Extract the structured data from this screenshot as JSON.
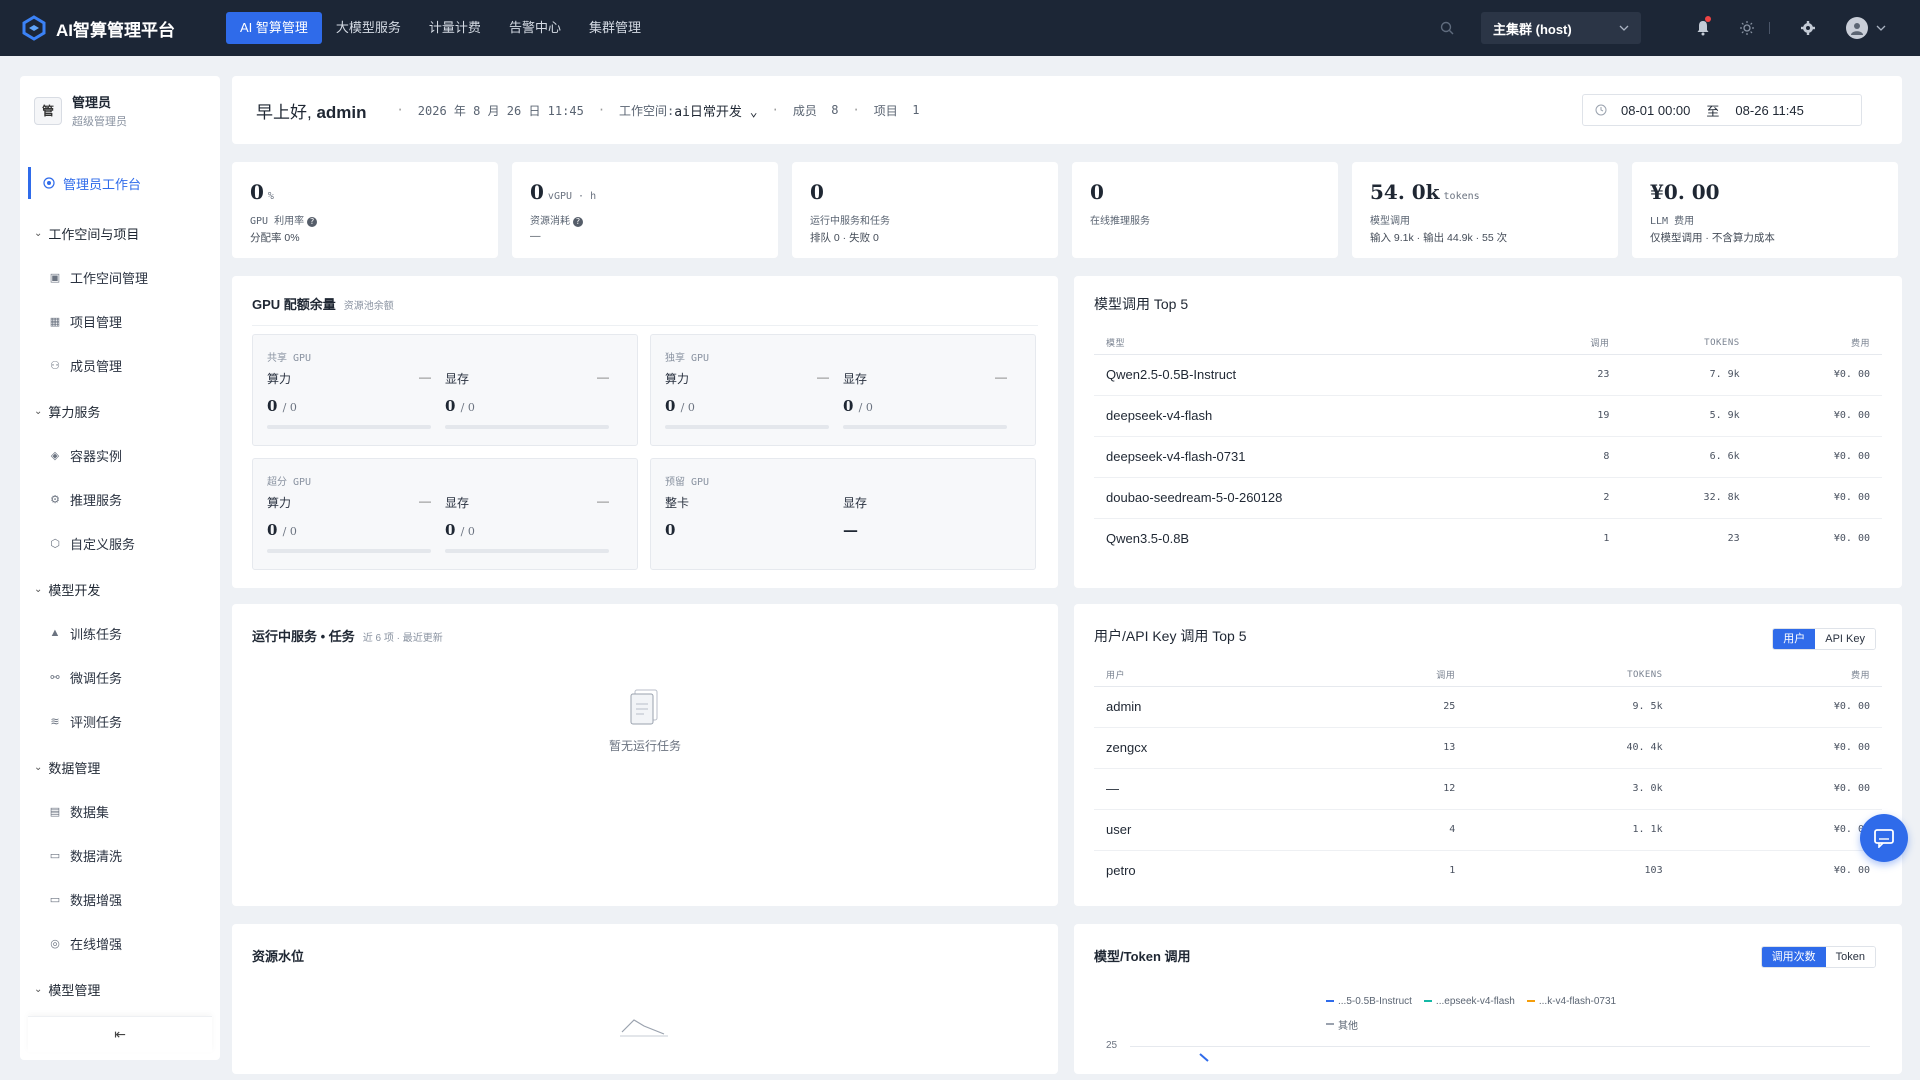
{
  "app": {
    "name": "AI智算管理平台"
  },
  "topnav": [
    {
      "label": "AI 智算管理",
      "active": true
    },
    {
      "label": "大模型服务"
    },
    {
      "label": "计量计费"
    },
    {
      "label": "告警中心"
    },
    {
      "label": "集群管理"
    }
  ],
  "cluster": {
    "label": "主集群 (host)"
  },
  "sidebar": {
    "user_name": "管理员",
    "user_role": "超级管理员",
    "user_avatar": "管",
    "active_item": "管理员工作台",
    "groups": [
      {
        "label": "工作空间与项目",
        "items": [
          "工作空间管理",
          "项目管理",
          "成员管理"
        ]
      },
      {
        "label": "算力服务",
        "items": [
          "容器实例",
          "推理服务",
          "自定义服务"
        ]
      },
      {
        "label": "模型开发",
        "items": [
          "训练任务",
          "微调任务",
          "评测任务"
        ]
      },
      {
        "label": "数据管理",
        "items": [
          "数据集",
          "数据清洗",
          "数据增强",
          "在线增强"
        ]
      },
      {
        "label": "模型管理",
        "items": []
      }
    ]
  },
  "header": {
    "greeting": "早上好,",
    "user": "admin",
    "datetime": "2026 年 8 月 26 日 11:45",
    "workspace_label": "工作空间:",
    "workspace_value": "ai日常开发",
    "members_label": "成员",
    "members_value": "8",
    "projects_label": "项目",
    "projects_value": "1",
    "date_start": "08-01 00:00",
    "date_to": "至",
    "date_end": "08-26 11:45"
  },
  "stats": [
    {
      "value": "0",
      "unit": "%",
      "label": "GPU 利用率",
      "sub": "分配率 0%",
      "help": true
    },
    {
      "value": "0",
      "unit": "vGPU · h",
      "label": "资源消耗",
      "sub": "—",
      "help": true
    },
    {
      "value": "0",
      "unit": "",
      "label": "运行中服务和任务",
      "sub": "排队 0 · 失败 0"
    },
    {
      "value": "0",
      "unit": "",
      "label": "在线推理服务",
      "sub": ""
    },
    {
      "value": "54. 0k",
      "unit": "tokens",
      "label": "模型调用",
      "sub": "输入 9.1k · 输出 44.9k · 55 次"
    },
    {
      "value": "¥0. 00",
      "unit": "",
      "label": "LLM 费用",
      "sub": "仅模型调用 · 不含算力成本"
    }
  ],
  "gpu": {
    "title": "GPU 配额余量",
    "note": "资源池余额",
    "boxes": [
      {
        "title": "共享 GPU",
        "c1_label": "算力",
        "c1_dash": "—",
        "c1_value": "0",
        "c1_of": "/ 0",
        "c2_label": "显存",
        "c2_dash": "—",
        "c2_value": "0",
        "c2_of": "/ 0",
        "bars": true
      },
      {
        "title": "独享 GPU",
        "c1_label": "算力",
        "c1_dash": "—",
        "c1_value": "0",
        "c1_of": "/ 0",
        "c2_label": "显存",
        "c2_dash": "—",
        "c2_value": "0",
        "c2_of": "/ 0",
        "bars": true
      },
      {
        "title": "超分 GPU",
        "c1_label": "算力",
        "c1_dash": "—",
        "c1_value": "0",
        "c1_of": "/ 0",
        "c2_label": "显存",
        "c2_dash": "—",
        "c2_value": "0",
        "c2_of": "/ 0",
        "bars": true
      },
      {
        "title": "预留 GPU",
        "c1_label": "整卡",
        "c1_dash": "",
        "c1_value": "0",
        "c1_of": "",
        "c2_label": "显存",
        "c2_dash": "",
        "c2_value": "—",
        "c2_of": "",
        "bars": false
      }
    ]
  },
  "model_top5": {
    "title": "模型调用 Top 5",
    "columns": [
      "模型",
      "调用",
      "TOKENS",
      "费用"
    ],
    "rows": [
      [
        "Qwen2.5-0.5B-Instruct",
        "23",
        "7. 9k",
        "¥0. 00"
      ],
      [
        "deepseek-v4-flash",
        "19",
        "5. 9k",
        "¥0. 00"
      ],
      [
        "deepseek-v4-flash-0731",
        "8",
        "6. 6k",
        "¥0. 00"
      ],
      [
        "doubao-seedream-5-0-260128",
        "2",
        "32. 8k",
        "¥0. 00"
      ],
      [
        "Qwen3.5-0.8B",
        "1",
        "23",
        "¥0. 00"
      ]
    ]
  },
  "running": {
    "title": "运行中服务 • 任务",
    "note": "近 6 项 · 最近更新",
    "empty": "暂无运行任务"
  },
  "user_top5": {
    "title": "用户/API Key 调用 Top 5",
    "toggle": [
      "用户",
      "API Key"
    ],
    "columns": [
      "用户",
      "调用",
      "TOKENS",
      "费用"
    ],
    "rows": [
      [
        "admin",
        "25",
        "9. 5k",
        "¥0. 00"
      ],
      [
        "zengcx",
        "13",
        "40. 4k",
        "¥0. 00"
      ],
      [
        "—",
        "12",
        "3. 0k",
        "¥0. 00"
      ],
      [
        "user",
        "4",
        "1. 1k",
        "¥0. 00"
      ],
      [
        "petro",
        "1",
        "103",
        "¥0. 00"
      ]
    ]
  },
  "water": {
    "title": "资源水位"
  },
  "model_token": {
    "title": "模型/Token 调用",
    "toggle": [
      "调用次数",
      "Token"
    ],
    "legend": [
      {
        "name": "...5-0.5B-Instruct",
        "color": "#2f6bea"
      },
      {
        "name": "...epseek-v4-flash",
        "color": "#14b8a6"
      },
      {
        "name": "...k-v4-flash-0731",
        "color": "#f59e0b"
      },
      {
        "name": "其他",
        "color": "#9aa2ae"
      }
    ],
    "y_tick": "25"
  },
  "colors": {
    "accent": "#2f6bea",
    "topbar": "#1c2636"
  }
}
